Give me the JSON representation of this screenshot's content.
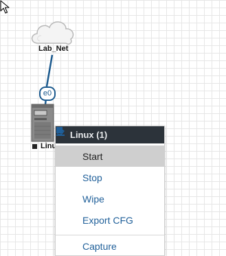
{
  "topology": {
    "cloud_node": {
      "label": "Lab_Net",
      "icon": "cloud-icon"
    },
    "interface": {
      "label": "e0"
    },
    "linux_node": {
      "label": "Linu",
      "icon": "server-tower-icon",
      "status": "stopped"
    }
  },
  "context_menu": {
    "title": "Linux (1)",
    "items": [
      {
        "label": "Start",
        "icon": "play-icon"
      },
      {
        "label": "Stop",
        "icon": "stop-icon"
      },
      {
        "label": "Wipe",
        "icon": "eraser-icon"
      },
      {
        "label": "Export CFG",
        "icon": "download-icon"
      }
    ],
    "partial_item": {
      "label": "Capture",
      "icon": "capture-icon"
    }
  },
  "colors": {
    "menu_header_bg": "#2c333a",
    "menu_item_text": "#1f5f99",
    "link_line": "#1c5a8e",
    "hover_bg": "#cfcfcf"
  }
}
